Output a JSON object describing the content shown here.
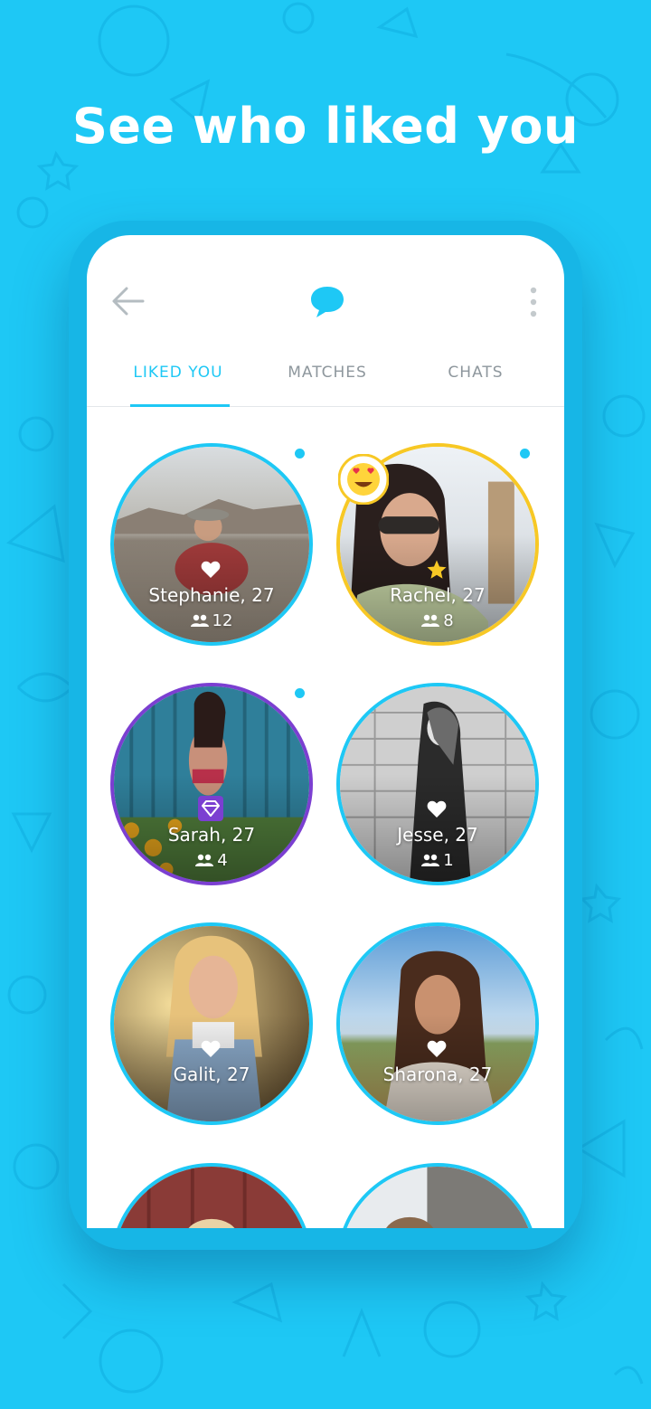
{
  "headline": "See who liked you",
  "header": {
    "back_icon": "arrow-left-icon",
    "logo_icon": "speech-bubble-icon",
    "more_icon": "more-vertical-icon"
  },
  "tabs": [
    {
      "label": "LIKED YOU",
      "active": true
    },
    {
      "label": "MATCHES",
      "active": false
    },
    {
      "label": "CHATS",
      "active": false
    }
  ],
  "profiles": [
    {
      "name": "Stephanie, 27",
      "friends": "12",
      "badge": "heart-icon",
      "ring": "#1ec8f5",
      "new": true
    },
    {
      "name": "Rachel, 27",
      "friends": "8",
      "badge": "star-icon",
      "ring": "#f7c825",
      "new": true,
      "emoji": "heart-eyes-emoji-icon"
    },
    {
      "name": "Sarah, 27",
      "friends": "4",
      "badge": "diamond-icon",
      "ring": "#7b3fd1",
      "new": true
    },
    {
      "name": "Jesse, 27",
      "friends": "1",
      "badge": "heart-icon",
      "ring": "#1ec8f5",
      "new": false
    },
    {
      "name": "Galit, 27",
      "badge": "heart-icon",
      "ring": "#1ec8f5",
      "new": false
    },
    {
      "name": "Sharona, 27",
      "badge": "heart-icon",
      "ring": "#1ec8f5",
      "new": false
    }
  ],
  "colors": {
    "brand": "#1ec8f5",
    "gold": "#f7c825",
    "purple": "#7b3fd1",
    "tab_inactive": "#8e979d"
  }
}
